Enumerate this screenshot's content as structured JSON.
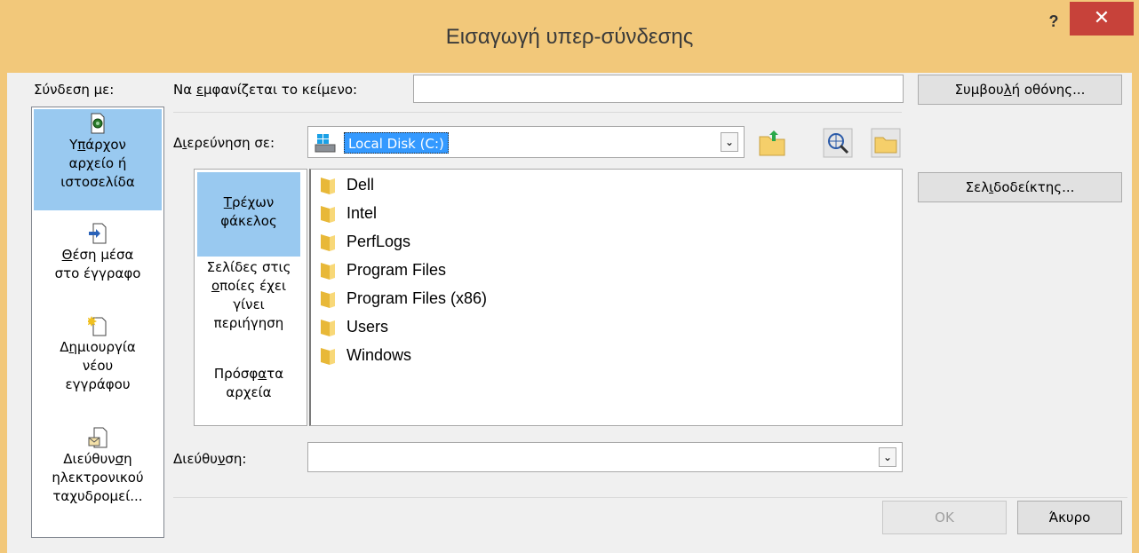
{
  "window": {
    "title": "Εισαγωγή υπερ-σύνδεσης",
    "help": "?",
    "close": "✕"
  },
  "linkwith": {
    "label": "Σύνδεση με:",
    "items": [
      {
        "line1_pre": "Υ",
        "line1_u": "π",
        "line1_post": "άρχον",
        "line2": "αρχείο ή",
        "line3": "ιστοσελίδα",
        "icon": "existing-file-icon"
      },
      {
        "line1_u": "Θ",
        "line1_post": "έση μέσα",
        "line2": "στο έγγραφο",
        "icon": "place-in-document-icon"
      },
      {
        "line1_pre": "Δ",
        "line1_u": "η",
        "line1_post": "μιουργία",
        "line2": "νέου",
        "line3": "εγγράφου",
        "icon": "new-document-icon"
      },
      {
        "line1_pre": "Διεύθυν",
        "line1_u": "σ",
        "line1_post": "η",
        "line2": "ηλεκτρονικού",
        "line3": "ταχυδρομεί...",
        "icon": "email-address-icon"
      }
    ]
  },
  "text_to_display": {
    "label_pre": "Να ",
    "label_u": "ε",
    "label_post": "μφανίζεται το κείμενο:",
    "value": ""
  },
  "screentip_button": {
    "pre": "Συμβου",
    "u": "λ",
    "post": "ή οθόνης..."
  },
  "look_in": {
    "label_pre": "Δ",
    "label_u": "ι",
    "label_post": "ερεύνηση σε:",
    "value": "Local Disk (C:)"
  },
  "bookmark_button": {
    "pre": "Σελ",
    "u": "ι",
    "post": "δοδείκτης..."
  },
  "places": [
    {
      "u": "Τ",
      "rest": "ρέχων",
      "line2": "φάκελος"
    },
    {
      "line1": "Σελίδες στις",
      "u": "ο",
      "rest": "ποίες έχει",
      "line3": "γίνει",
      "line4": "περιήγηση"
    },
    {
      "pre": "Πρόσφ",
      "u": "α",
      "rest": "τα",
      "line2": "αρχεία"
    }
  ],
  "files": [
    "Dell",
    "Intel",
    "PerfLogs",
    "Program Files",
    "Program Files (x86)",
    "Users",
    "Windows"
  ],
  "address": {
    "label_pre": "Διεύθυ",
    "label_u": "ν",
    "label_post": "ση:",
    "value": ""
  },
  "buttons": {
    "ok": "OK",
    "cancel": "Άκυρο"
  }
}
